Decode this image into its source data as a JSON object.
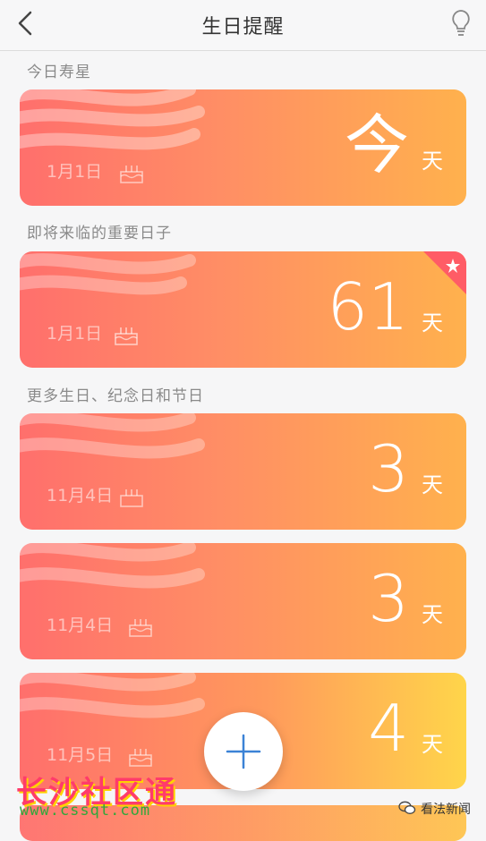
{
  "nav": {
    "title": "生日提醒"
  },
  "sections": {
    "today": "今日寿星",
    "upcoming": "即将来临的重要日子",
    "more": "更多生日、纪念日和节日"
  },
  "cards": [
    {
      "date": "1月1日",
      "count": "今",
      "unit": "天"
    },
    {
      "date": "1月1日",
      "count": "61",
      "unit": "天"
    },
    {
      "date": "11月4日",
      "count": "3",
      "unit": "天"
    },
    {
      "date": "11月4日",
      "count": "3",
      "unit": "天"
    },
    {
      "date": "11月5日",
      "count": "4",
      "unit": "天"
    }
  ],
  "watermark": {
    "text": "长沙社区通",
    "url": "www.cssqt.com"
  },
  "wechat": {
    "label": "看法新闻"
  },
  "colors": {
    "card_start": "#ff6f6c",
    "card_end": "#ffb14d",
    "accent_plus": "#3b82d6",
    "corner_ribbon": "#ff5c66"
  },
  "icons": [
    "back-arrow-icon",
    "lightbulb-icon",
    "cake-icon",
    "star-icon",
    "plus-icon",
    "wechat-icon"
  ]
}
